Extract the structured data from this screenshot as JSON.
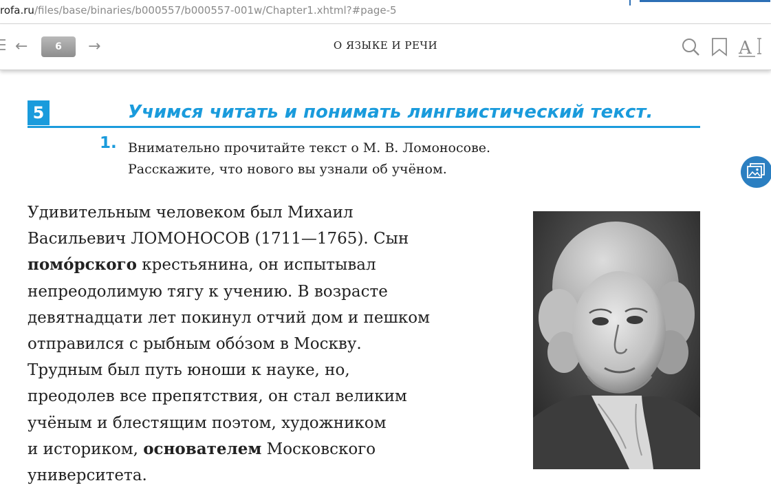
{
  "browser": {
    "url_host": "rofa.ru",
    "url_path": "/files/base/binaries/b000557/b000557-001w/Chapter1.xhtml?#page-5"
  },
  "toolbar": {
    "page_number": "6",
    "book_title": "О ЯЗЫКЕ И РЕЧИ",
    "back_arrow": "←",
    "forward_arrow": "→",
    "icons": [
      "menu-icon",
      "search-icon",
      "bookmark-icon",
      "font-size-icon"
    ]
  },
  "lesson": {
    "number": "5",
    "title": "Учимся читать и понимать лингвистический текст."
  },
  "task": {
    "number": "1.",
    "lines": [
      "Внимательно прочитайте текст о М. В. Ломоносове.",
      "Расскажите, что нового вы узнали об учёном."
    ]
  },
  "text": {
    "l1": "Удивительным человеком был Михаил",
    "l2": "Васильевич ЛОМОНОСОВ (1711—1765). Сын",
    "l3_bold": "помо́рского",
    "l3_rest": " крестьянина, он испытывал",
    "l4": "непреодолимую тягу к учению. В возрасте",
    "l5": "девятнадцати лет покинул отчий дом и пешком",
    "l6": "отправился с рыбным обо́зом в Москву.",
    "l7": "Трудным был путь юноши к науке, но,",
    "l8": "преодолев все препятствия, он стал великим",
    "l9": "учёным и блестящим поэтом, художником",
    "l10_start": "и историком, ",
    "l10_bold": "основателем",
    "l10_rest": " Московского",
    "l11": "университета."
  },
  "colors": {
    "accent": "#1a9bdc",
    "gallery_button": "#2b7fc1",
    "toolbar_icons": "#8c8c8c"
  },
  "sidebar": {
    "gallery_icon": "gallery-icon"
  },
  "portrait": {
    "subject_icon": "portrait-engraving"
  }
}
